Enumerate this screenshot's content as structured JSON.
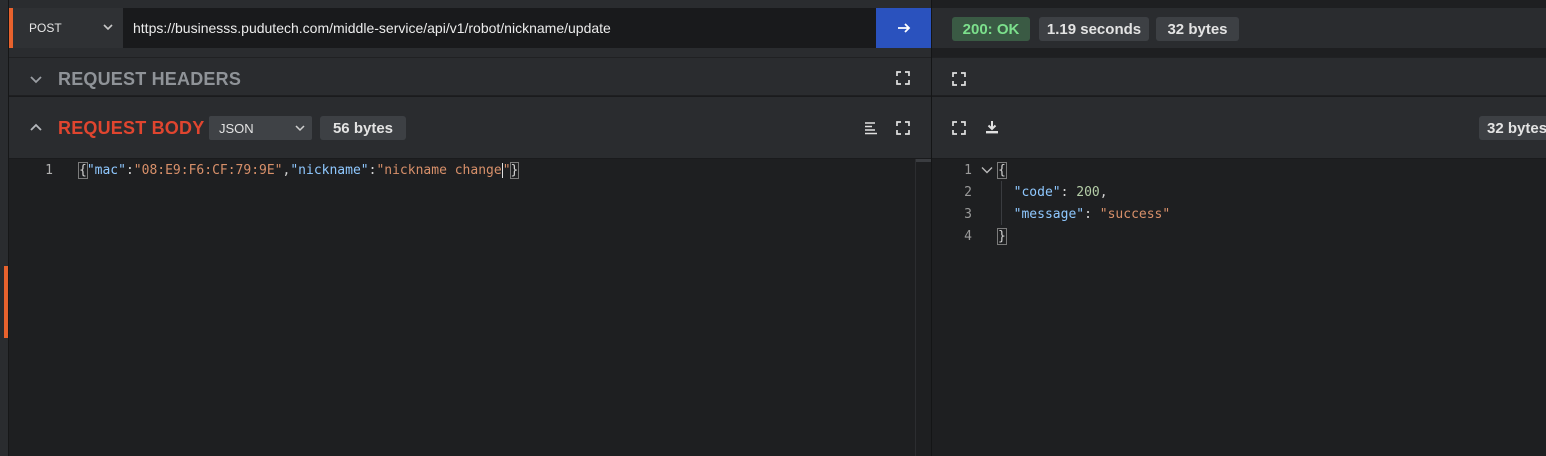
{
  "request": {
    "method": "POST",
    "url": "https://businesss.pudutech.com/middle-service/api/v1/robot/nickname/update",
    "headers_title": "REQUEST HEADERS",
    "body_title": "REQUEST BODY",
    "body_format": "JSON",
    "body_size": "56 bytes",
    "body_lines": [
      {
        "number": "1",
        "tokens": [
          {
            "t": "{",
            "c": "p brace"
          },
          {
            "t": "\"mac\"",
            "c": "k"
          },
          {
            "t": ":",
            "c": "p"
          },
          {
            "t": "\"08:E9:F6:CF:79:9E\"",
            "c": "s"
          },
          {
            "t": ",",
            "c": "p"
          },
          {
            "t": "\"nickname\"",
            "c": "k"
          },
          {
            "t": ":",
            "c": "p"
          },
          {
            "t": "\"nickname change",
            "c": "s"
          },
          {
            "t": "|cursor|",
            "c": "cursor"
          },
          {
            "t": "\"",
            "c": "s"
          },
          {
            "t": "}",
            "c": "p brace"
          }
        ]
      }
    ]
  },
  "response": {
    "status": "200: OK",
    "time": "1.19 seconds",
    "size": "32 bytes",
    "body_size": "32 bytes",
    "body_lines": [
      {
        "number": "1",
        "fold": true,
        "tokens": [
          {
            "t": "{",
            "c": "p brace"
          }
        ]
      },
      {
        "number": "2",
        "fold": false,
        "tokens": [
          {
            "t": "  ",
            "c": "p"
          },
          {
            "t": "\"code\"",
            "c": "k"
          },
          {
            "t": ": ",
            "c": "p"
          },
          {
            "t": "200",
            "c": "n"
          },
          {
            "t": ",",
            "c": "p"
          }
        ]
      },
      {
        "number": "3",
        "fold": false,
        "tokens": [
          {
            "t": "  ",
            "c": "p"
          },
          {
            "t": "\"message\"",
            "c": "k"
          },
          {
            "t": ": ",
            "c": "p"
          },
          {
            "t": "\"success\"",
            "c": "s"
          }
        ]
      },
      {
        "number": "4",
        "fold": false,
        "tokens": [
          {
            "t": "}",
            "c": "p brace"
          }
        ]
      }
    ]
  },
  "colors": {
    "accent_orange": "#e8622d",
    "send_blue": "#2a52be",
    "body_title_red": "#e0452f",
    "status_green": "#7ce08c"
  },
  "icons": [
    "chevron-down-icon",
    "arrow-right-icon",
    "chevron-up-icon",
    "expand-icon",
    "format-lines-icon",
    "download-icon"
  ]
}
